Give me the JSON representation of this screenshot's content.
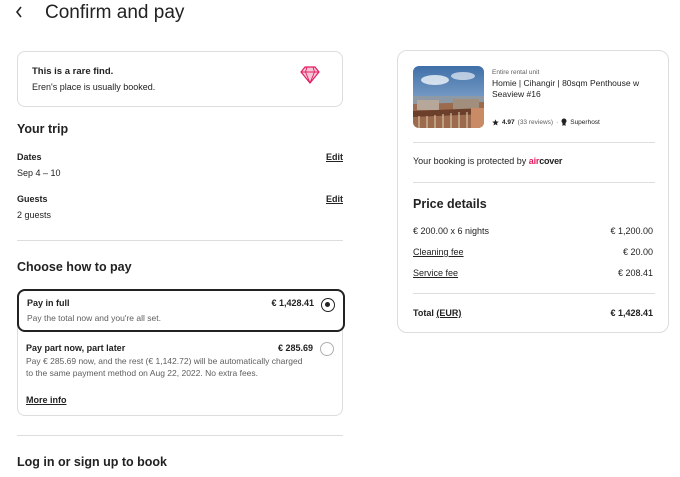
{
  "header": {
    "back_glyph": "‹",
    "title": "Confirm and pay"
  },
  "rare_find": {
    "title": "This is a rare find.",
    "subtitle": "Eren's place is usually booked.",
    "icon": "diamond-icon",
    "icon_color": "#e31c5f"
  },
  "trip": {
    "title": "Your trip",
    "dates": {
      "label": "Dates",
      "value": "Sep 4 – 10",
      "edit": "Edit"
    },
    "guests": {
      "label": "Guests",
      "value": "2 guests",
      "edit": "Edit"
    }
  },
  "payment": {
    "title": "Choose how to pay",
    "options": [
      {
        "title": "Pay in full",
        "price": "€ 1,428.41",
        "desc": "Pay the total now and you're all set.",
        "selected": true
      },
      {
        "title": "Pay part now, part later",
        "price": "€ 285.69",
        "desc": "Pay € 285.69 now, and the rest (€ 1,142.72) will be automatically charged to the same payment method on Aug 22, 2022. No extra fees.",
        "more": "More info",
        "selected": false
      }
    ]
  },
  "login": {
    "title": "Log in or sign up to book"
  },
  "listing": {
    "unit_type": "Entire rental unit",
    "name": "Homie | Cihangir | 80sqm Penthouse w Seaview #16",
    "rating": "4.97",
    "reviews": "(33 reviews)",
    "separator": "·",
    "superhost": "Superhost",
    "protected_text": "Your booking is protected by",
    "aircover_air": "air",
    "aircover_cover": "cover"
  },
  "price_details": {
    "title": "Price details",
    "rows": [
      {
        "label": "€ 200.00 x 6 nights",
        "value": "€ 1,200.00",
        "link": false
      },
      {
        "label": "Cleaning fee",
        "value": "€ 20.00",
        "link": true
      },
      {
        "label": "Service fee",
        "value": "€ 208.41",
        "link": true
      }
    ],
    "total_label": "Total",
    "total_currency": "(EUR)",
    "total_value": "€ 1,428.41"
  }
}
